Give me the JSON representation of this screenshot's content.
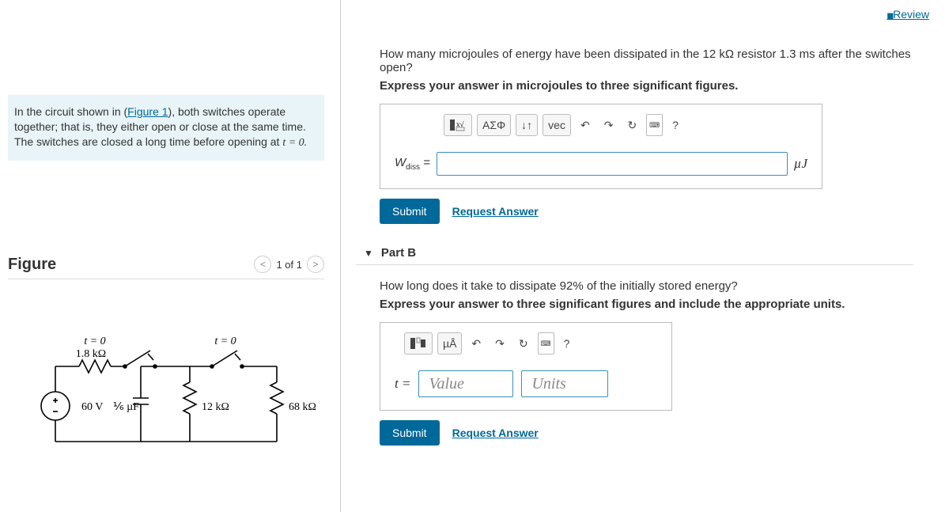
{
  "topbar": {
    "review": "Review"
  },
  "intro": {
    "pre": "In the circuit shown in (",
    "fig_link": "Figure 1",
    "post": "), both switches operate together; that is, they either open or close at the same time. The switches are closed a long time before opening at ",
    "tail": "t = 0."
  },
  "figure_panel": {
    "title": "Figure",
    "page": "1 of 1"
  },
  "circuit": {
    "sw1": "t = 0",
    "sw2": "t = 0",
    "r1": "1.8 kΩ",
    "vsrc": "60 V",
    "cap": "⅙ µF",
    "r2": "12 kΩ",
    "r3": "68 kΩ"
  },
  "partA": {
    "q": "How many microjoules of energy have been dissipated in the 12 kΩ resistor 1.3 ms after the switches open?",
    "instr": "Express your answer in microjoules to three significant figures.",
    "var": "Wdiss =",
    "unit_suffix": "µJ",
    "submit": "Submit",
    "request": "Request Answer",
    "tool_greek": "ΑΣΦ",
    "tool_vec": "vec",
    "tool_q": "?"
  },
  "partB": {
    "header": "Part B",
    "q": "How long does it take to dissipate 92% of the initially stored energy?",
    "instr": "Express your answer to three significant figures and include the appropriate units.",
    "var": "t =",
    "value_ph": "Value",
    "units_ph": "Units",
    "submit": "Submit",
    "request": "Request Answer",
    "tool_units": "µÅ",
    "tool_q": "?"
  }
}
